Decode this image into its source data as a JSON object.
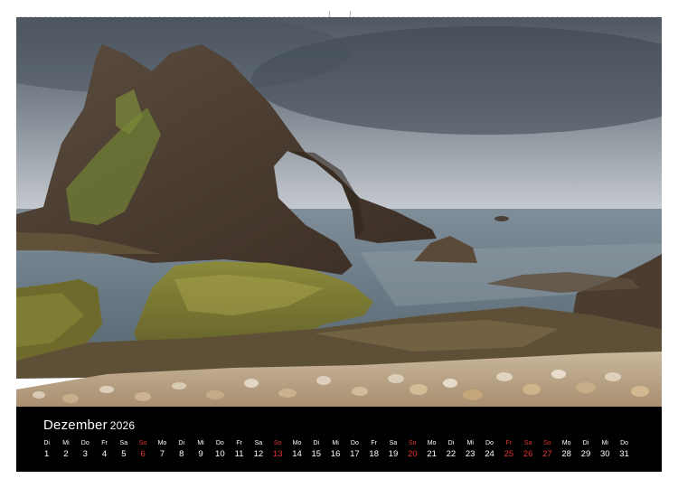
{
  "calendar": {
    "month": "Dezember",
    "year": "2026",
    "colors": {
      "background": "#000000",
      "text": "#ffffff",
      "highlight": "#e3342f"
    },
    "days": [
      {
        "wd": "Di",
        "num": "1"
      },
      {
        "wd": "Mi",
        "num": "2"
      },
      {
        "wd": "Do",
        "num": "3"
      },
      {
        "wd": "Fr",
        "num": "4"
      },
      {
        "wd": "Sa",
        "num": "5"
      },
      {
        "wd": "So",
        "num": "6",
        "red": true
      },
      {
        "wd": "Mo",
        "num": "7"
      },
      {
        "wd": "Di",
        "num": "8"
      },
      {
        "wd": "Mi",
        "num": "9"
      },
      {
        "wd": "Do",
        "num": "10"
      },
      {
        "wd": "Fr",
        "num": "11"
      },
      {
        "wd": "Sa",
        "num": "12"
      },
      {
        "wd": "So",
        "num": "13",
        "red": true
      },
      {
        "wd": "Mo",
        "num": "14"
      },
      {
        "wd": "Di",
        "num": "15"
      },
      {
        "wd": "Mi",
        "num": "16"
      },
      {
        "wd": "Do",
        "num": "17"
      },
      {
        "wd": "Fr",
        "num": "18"
      },
      {
        "wd": "Sa",
        "num": "19"
      },
      {
        "wd": "So",
        "num": "20",
        "red": true
      },
      {
        "wd": "Mo",
        "num": "21"
      },
      {
        "wd": "Di",
        "num": "22"
      },
      {
        "wd": "Mi",
        "num": "23"
      },
      {
        "wd": "Do",
        "num": "24"
      },
      {
        "wd": "Fr",
        "num": "25",
        "red": true
      },
      {
        "wd": "Sa",
        "num": "26",
        "red": true
      },
      {
        "wd": "So",
        "num": "27",
        "red": true
      },
      {
        "wd": "Mo",
        "num": "28"
      },
      {
        "wd": "Di",
        "num": "29"
      },
      {
        "wd": "Mi",
        "num": "30"
      },
      {
        "wd": "Do",
        "num": "31"
      }
    ]
  }
}
